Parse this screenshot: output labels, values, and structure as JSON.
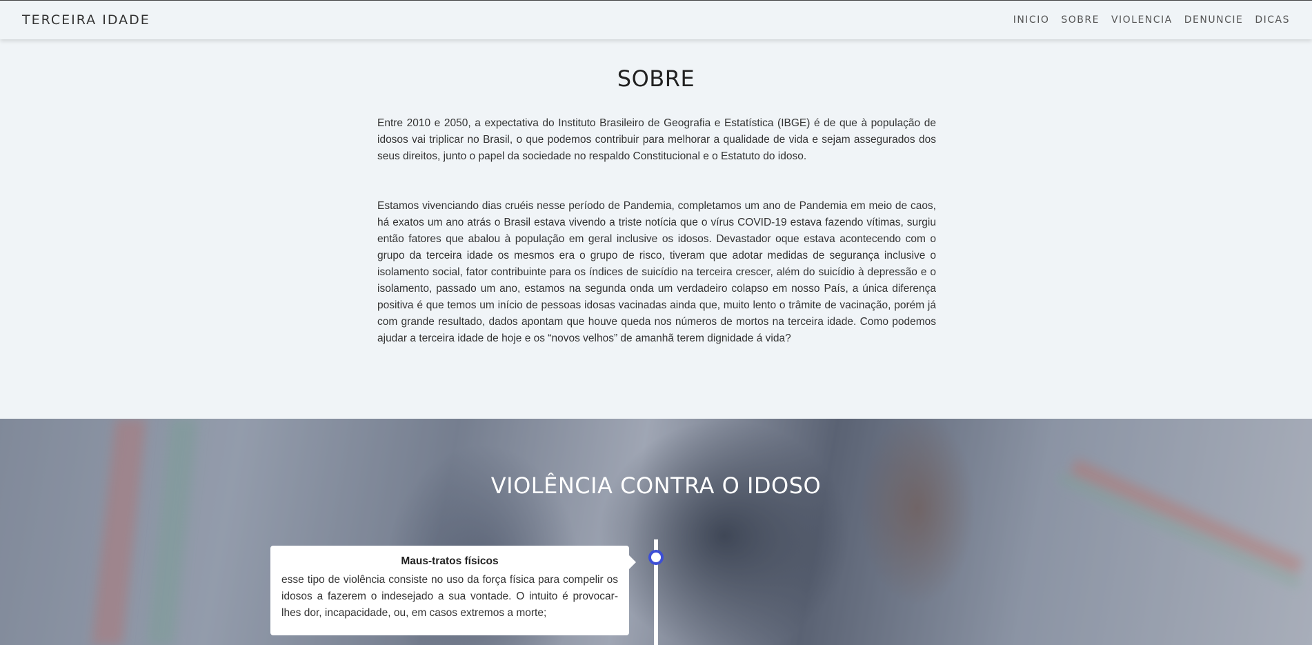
{
  "navbar": {
    "brand": "TERCEIRA IDADE",
    "links": [
      "INICIO",
      "SOBRE",
      "VIOLENCIA",
      "DENUNCIE",
      "DICAS"
    ]
  },
  "sobre": {
    "title": "SOBRE",
    "paragraph1": "Entre 2010 e 2050, a expectativa do Instituto Brasileiro de Geografia e Estatística (IBGE) é de que à população de idosos vai triplicar no Brasil, o que podemos contribuir para melhorar a qualidade de vida e sejam assegurados dos seus direitos, junto o papel da sociedade no respaldo Constitucional e o Estatuto do idoso.",
    "paragraph2": "Estamos vivenciando dias cruéis nesse período de Pandemia, completamos um ano de Pandemia em meio de caos, há exatos um ano atrás o Brasil estava vivendo a triste notícia que o vírus COVID-19 estava fazendo vítimas, surgiu então fatores que abalou à população em geral inclusive os idosos. Devastador oque estava acontecendo com o grupo da terceira idade os mesmos era o grupo de risco, tiveram que adotar medidas de segurança inclusive o isolamento social, fator contribuinte para os índices de suicídio na terceira crescer, além do suicídio à depressão e o isolamento, passado um ano, estamos na segunda onda um verdadeiro colapso em nosso País, a única diferença positiva é que temos um início de pessoas idosas vacinadas ainda que, muito lento o trâmite de vacinação, porém já com grande resultado, dados apontam que houve queda nos números de mortos na terceira idade. Como podemos ajudar a terceira idade de hoje e os “novos velhos” de amanhã terem dignidade á vida?"
  },
  "violencia": {
    "title": "VIOLÊNCIA CONTRA O IDOSO",
    "timeline": [
      {
        "title": "Maus-tratos físicos",
        "text": "esse tipo de violência consiste no uso da força física para compelir os idosos a fazerem o indesejado a sua vontade. O intuito é  provocar-lhes dor, incapacidade, ou, em casos extremos a morte;"
      }
    ]
  },
  "colors": {
    "background": "#f0f4f7",
    "timeline_accent": "#3d4fd6",
    "card": "#ffffff"
  }
}
